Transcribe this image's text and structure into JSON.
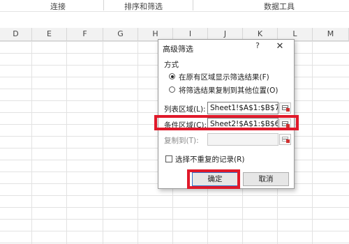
{
  "ribbon": {
    "groups": [
      "连接",
      "排序和筛选",
      "数据工具"
    ]
  },
  "sheet": {
    "columns": [
      "D",
      "E",
      "F",
      "G",
      "H",
      "I",
      "J",
      "K",
      "L",
      "M"
    ]
  },
  "dialog": {
    "title": "高级筛选",
    "help_label": "?",
    "close_label": "✕",
    "method_label": "方式",
    "options": [
      {
        "label": "在原有区域显示筛选结果(F)",
        "selected": true
      },
      {
        "label": "将筛选结果复制到其他位置(O)",
        "selected": false
      }
    ],
    "list_range_label": "列表区域(L):",
    "list_range_value": "Sheet1!$A$1:$B$7",
    "criteria_range_label": "条件区域(C):",
    "criteria_range_value": "Sheet2!$A$1:$B$6",
    "copy_to_label": "复制到(T):",
    "copy_to_value": "",
    "unique_label": "选择不重复的记录(R)",
    "unique_checked": false,
    "ok_label": "确定",
    "cancel_label": "取消"
  },
  "highlight_color": "#e0192a"
}
